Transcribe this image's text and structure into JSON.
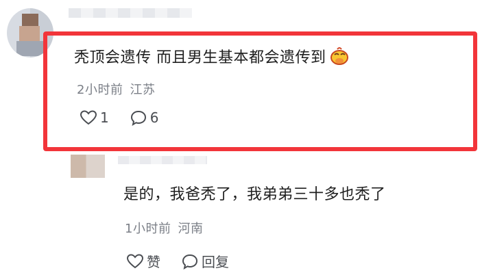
{
  "comment": {
    "text": "秃顶会遗传 而且男生基本都会遗传到",
    "emoji": "smirk-face-emoji",
    "time": "2小时前",
    "location": "江苏",
    "like_count": "1",
    "reply_count": "6"
  },
  "reply": {
    "text": "是的，我爸秃了，我弟弟三十多也秃了",
    "time": "1小时前",
    "location": "河南",
    "like_label": "赞",
    "reply_label": "回复"
  },
  "colors": {
    "highlight_border": "#f2353a",
    "secondary_text": "#7b7f87",
    "primary_text": "#1e1e1e"
  }
}
